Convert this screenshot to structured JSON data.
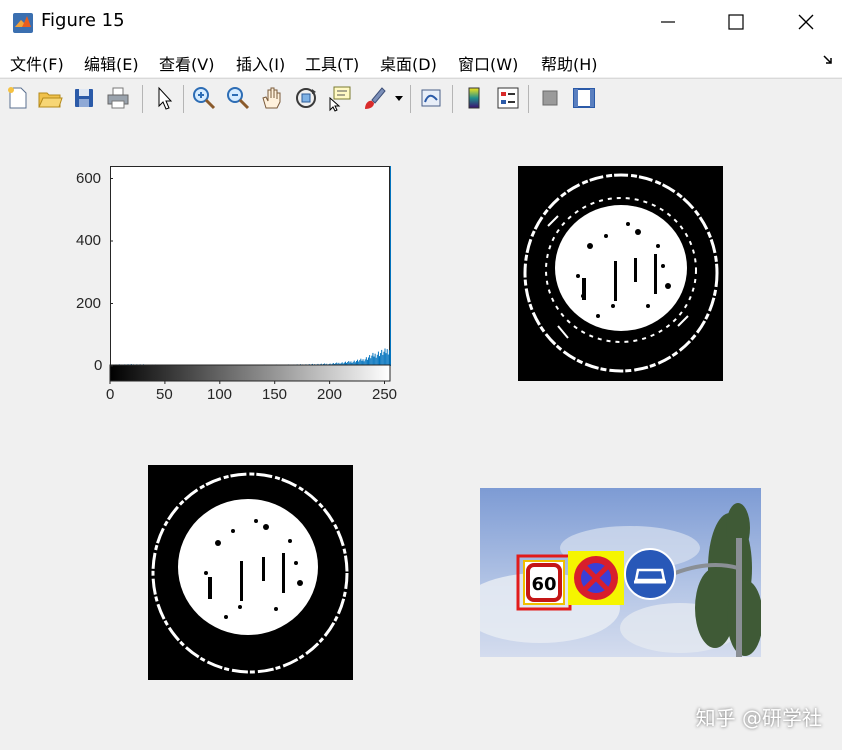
{
  "window": {
    "title": "Figure 15"
  },
  "menu": {
    "items": [
      "文件(F)",
      "编辑(E)",
      "查看(V)",
      "插入(I)",
      "工具(T)",
      "桌面(D)",
      "窗口(W)",
      "帮助(H)"
    ]
  },
  "toolbar": {
    "buttons": [
      "new-figure",
      "open-file",
      "save",
      "print",
      "edit-plot",
      "zoom-in",
      "zoom-out",
      "pan",
      "rotate-3d",
      "data-cursor",
      "brush",
      "link-plot",
      "colorbar",
      "legend",
      "hide-plot-tools",
      "show-plot-tools"
    ]
  },
  "chart_data": [
    {
      "type": "bar",
      "yticks": [
        "600",
        "400",
        "200",
        "0"
      ],
      "xticks": [
        "0",
        "50",
        "100",
        "150",
        "200",
        "250"
      ],
      "ylim": [
        0,
        640
      ],
      "xlim": [
        0,
        255
      ],
      "bar_color": "#0072bd",
      "bins_x": [
        0,
        20,
        40,
        60,
        80,
        100,
        120,
        140,
        160,
        180,
        200,
        210,
        220,
        230,
        235,
        240,
        245,
        250,
        254,
        255
      ],
      "bins_y": [
        4,
        5,
        4,
        3,
        4,
        3,
        3,
        4,
        4,
        5,
        7,
        10,
        14,
        20,
        28,
        35,
        42,
        45,
        55,
        640
      ],
      "colorbar": "grayscale 0-255"
    }
  ],
  "images": {
    "processed_1": "binary edge-processed sign",
    "processed_2": "binary edge-processed sign",
    "scene": "street signs with detection boxes"
  },
  "scene_sign_text": "60",
  "watermark": "知乎 @研学社"
}
